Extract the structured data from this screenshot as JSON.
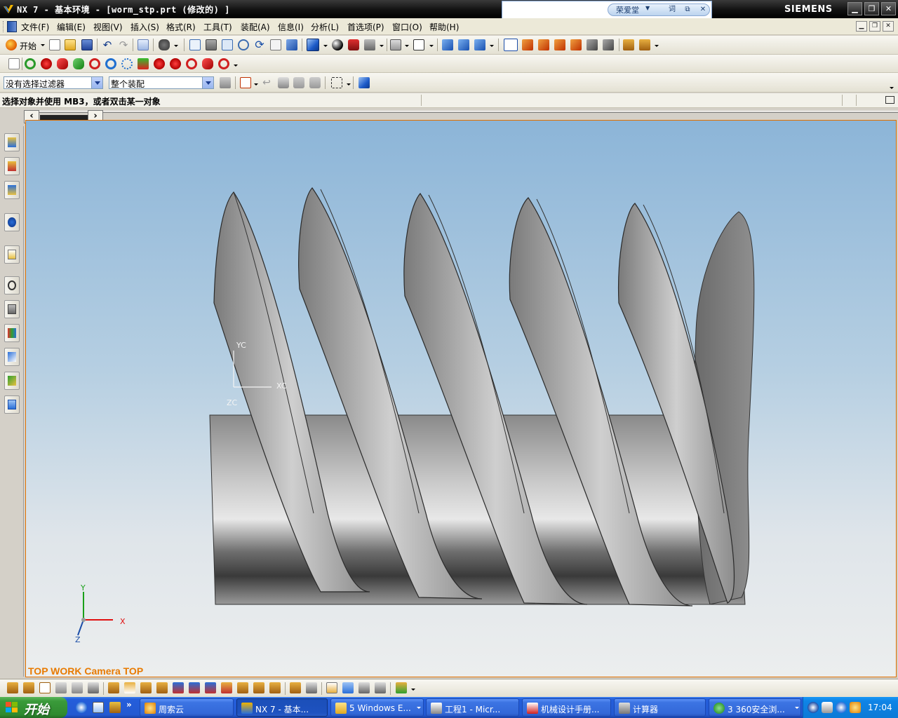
{
  "window": {
    "title": "NX 7 - 基本环境 - [worm_stp.prt  (修改的) ]",
    "brand": "SIEMENS",
    "controls": [
      "minimize",
      "restore",
      "close"
    ]
  },
  "dict_widget": {
    "user": "荣爱堂",
    "buttons": [
      "词",
      "⧉",
      "✕"
    ]
  },
  "menu": {
    "items": [
      "文件(F)",
      "编辑(E)",
      "视图(V)",
      "插入(S)",
      "格式(R)",
      "工具(T)",
      "装配(A)",
      "信息(I)",
      "分析(L)",
      "首选项(P)",
      "窗口(O)",
      "帮助(H)"
    ]
  },
  "toolbar": {
    "start_label": "开始"
  },
  "selection": {
    "filter_value": "没有选择过滤器",
    "scope_value": "整个装配"
  },
  "cue_line": {
    "text": "选择对象并使用 MB3，或者双击某一对象"
  },
  "graphics": {
    "view_label": "TOP WORK Camera TOP",
    "wcs_labels": {
      "x": "XC",
      "y": "YC",
      "z": "ZC"
    },
    "triad_labels": {
      "x": "X",
      "y": "Y",
      "z": "Z"
    }
  },
  "taskbar": {
    "start_label": "开始",
    "tasks": [
      {
        "label": "周索云",
        "active": false
      },
      {
        "label": "NX 7 - 基本...",
        "active": true
      },
      {
        "label": "5 Windows E...",
        "active": false
      },
      {
        "label": "工程1 - Micr...",
        "active": false
      },
      {
        "label": "机械设计手册...",
        "active": false
      },
      {
        "label": "计算器",
        "active": false
      },
      {
        "label": "3 360安全浏...",
        "active": false
      }
    ],
    "clock": "17:04"
  },
  "colors": {
    "title_bar": "#000000",
    "accent_orange": "#e87a00",
    "taskbar_blue": "#245edb",
    "start_green": "#3a9a3a"
  }
}
